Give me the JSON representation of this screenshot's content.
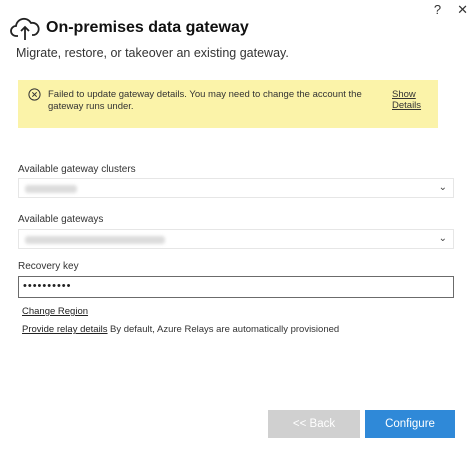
{
  "window": {
    "help": "?",
    "close": "✕"
  },
  "header": {
    "title": "On-premises data gateway",
    "subtitle": "Migrate, restore, or takeover an existing gateway."
  },
  "warning": {
    "message": "Failed to update gateway details. You may need to change the account the gateway runs under.",
    "link": "Show Details",
    "color": "#fbf3a9"
  },
  "fields": {
    "clusters_label": "Available gateway clusters",
    "gateways_label": "Available gateways",
    "recovery_label": "Recovery key",
    "recovery_value": "••••••••••"
  },
  "links": {
    "change_region": "Change Region",
    "relay_details": "Provide relay details",
    "relay_note": "By default, Azure Relays are automatically provisioned"
  },
  "buttons": {
    "back": "<< Back",
    "configure": "Configure",
    "accent": "#2f89d8"
  }
}
